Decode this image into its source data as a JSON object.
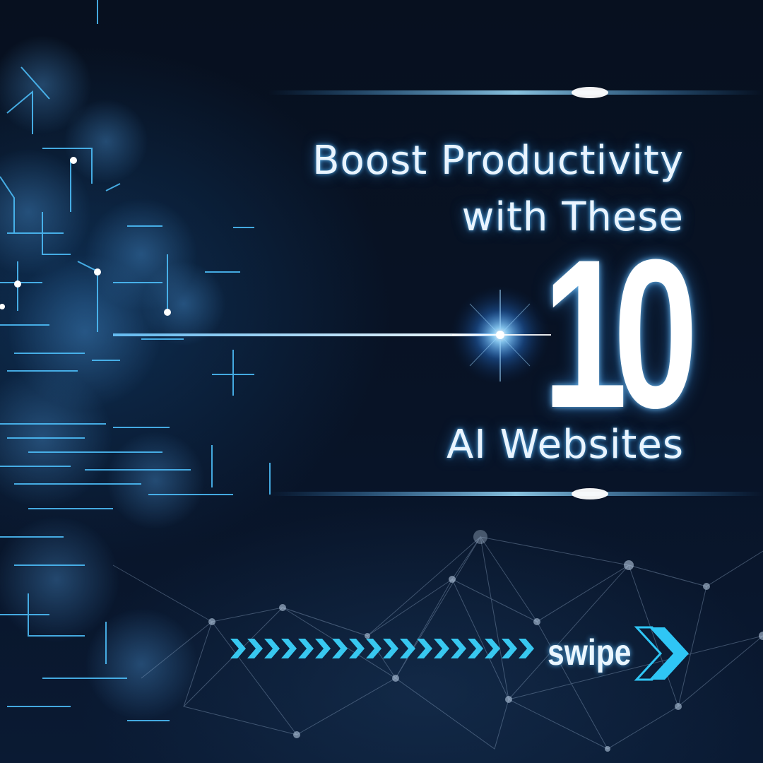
{
  "headline": {
    "line1": "Boost Productivity",
    "line2": "with These",
    "number": "10",
    "line3": "AI Websites"
  },
  "cta": {
    "label": "swipe",
    "icon": "double-chevron-right-icon"
  },
  "colors": {
    "background": "#050b18",
    "text": "#e9f4ff",
    "glow": "#3fa9ff",
    "accent": "#38c8f0"
  }
}
